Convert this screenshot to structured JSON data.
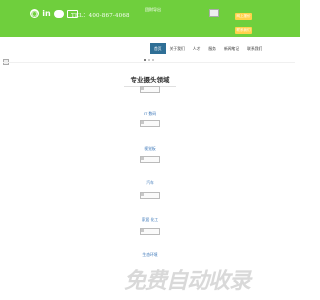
{
  "header": {
    "phone": "TEL：400-867-4068",
    "top_link": "团财导出",
    "login_label": "网上报价",
    "contact_label": "联系我们",
    "social_icons": [
      "weibo-icon",
      "linkedin-icon",
      "wechat-icon",
      "mail-icon"
    ]
  },
  "nav": {
    "items": [
      {
        "label": "首页",
        "active": true
      },
      {
        "label": "关于我们",
        "active": false
      },
      {
        "label": "人才",
        "active": false
      },
      {
        "label": "服务",
        "active": false
      },
      {
        "label": "新闻笔记",
        "active": false
      },
      {
        "label": "联系我们",
        "active": false
      }
    ]
  },
  "section": {
    "title": "专业摄头领域",
    "items": [
      {
        "label": "IT 数码"
      },
      {
        "label": "视觉板"
      },
      {
        "label": "汽车"
      },
      {
        "label": "家居 化工"
      },
      {
        "label": "生态环境"
      }
    ]
  },
  "watermark": {
    "text": "免费自动收录"
  },
  "colors": {
    "brand_green": "#6fcf3d",
    "accent_yellow": "#ffd24a",
    "nav_active": "#2f6f96",
    "link_blue": "#3a76b8"
  }
}
